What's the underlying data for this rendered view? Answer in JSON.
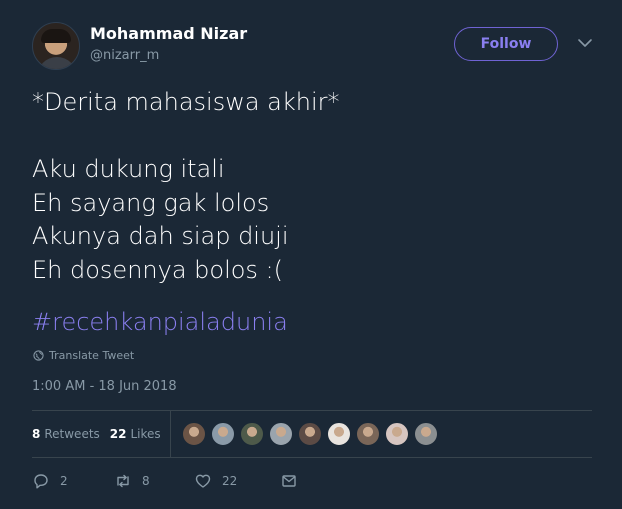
{
  "user": {
    "display_name": "Mohammad Nizar",
    "handle": "@nizarr_m"
  },
  "follow_label": "Follow",
  "tweet": {
    "lines": [
      "*Derita mahasiswa akhir*",
      "",
      "Aku dukung itali",
      "Eh sayang gak lolos",
      "Akunya dah siap diuji",
      "Eh dosennya bolos :("
    ],
    "hashtag": "#recehkanpialadunia"
  },
  "translate_label": "Translate Tweet",
  "timestamp": "1:00 AM - 18 Jun 2018",
  "stats": {
    "retweets_count": "8",
    "retweets_label": "Retweets",
    "likes_count": "22",
    "likes_label": "Likes"
  },
  "likers": [
    {
      "color": "#6b5446"
    },
    {
      "color": "#8a9aa8"
    },
    {
      "color": "#4e5a4a"
    },
    {
      "color": "#9aa4ad"
    },
    {
      "color": "#5c4b45"
    },
    {
      "color": "#e9e4df"
    },
    {
      "color": "#7a6658"
    },
    {
      "color": "#d6c5c0"
    },
    {
      "color": "#8b8f91"
    }
  ],
  "actions": {
    "reply_count": "2",
    "retweet_count": "8",
    "like_count": "22"
  },
  "colors": {
    "background": "#1b2836",
    "accent": "#8a7ff0",
    "muted": "#8899a6"
  }
}
